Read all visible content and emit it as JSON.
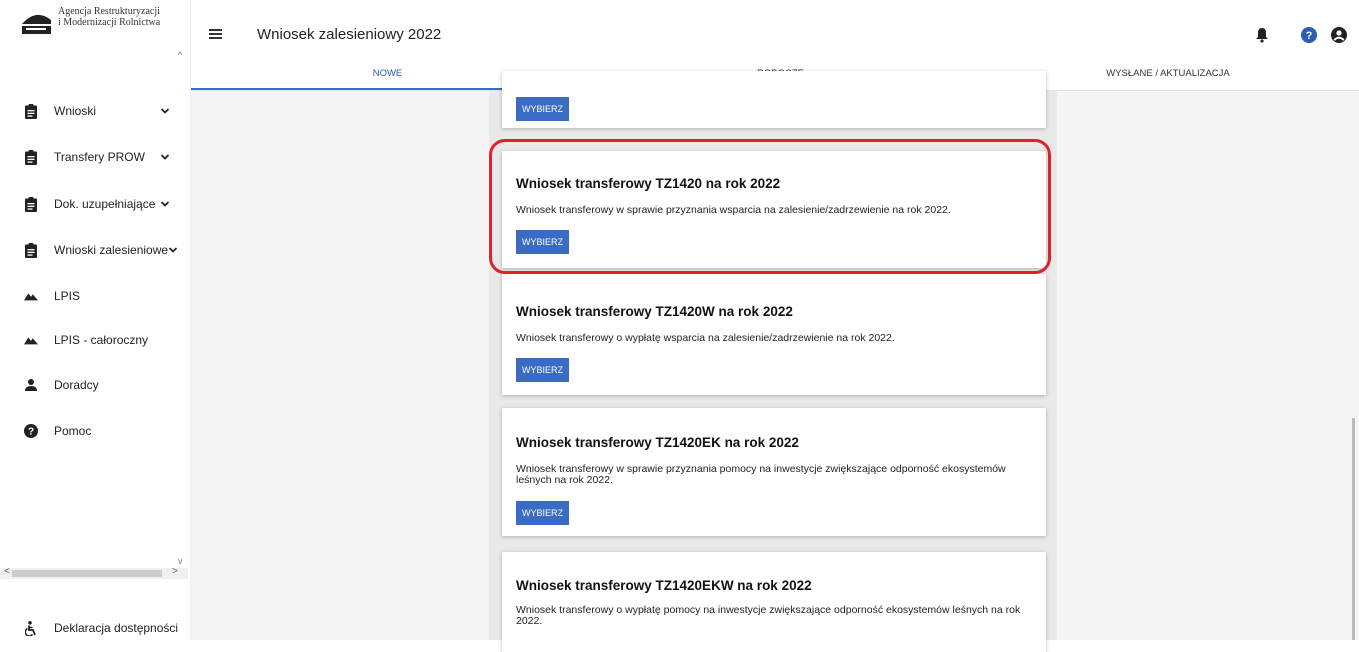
{
  "logo": {
    "line1": "Agencja Restrukturyzacji",
    "line2": "i Modernizacji Rolnictwa"
  },
  "sidebar": {
    "items": [
      {
        "label": "Wnioski",
        "icon": "clipboard-icon",
        "has_chevron": true
      },
      {
        "label": "Transfery PROW",
        "icon": "clipboard-icon",
        "has_chevron": true
      },
      {
        "label": "Dok. uzupełniające",
        "icon": "clipboard-icon",
        "has_chevron": true
      },
      {
        "label": "Wnioski zalesieniowe",
        "icon": "clipboard-icon",
        "has_chevron": true
      },
      {
        "label": "LPIS",
        "icon": "terrain-icon",
        "has_chevron": false
      },
      {
        "label": "LPIS - całoroczny",
        "icon": "terrain-icon",
        "has_chevron": false
      },
      {
        "label": "Doradcy",
        "icon": "person-icon",
        "has_chevron": false
      },
      {
        "label": "Pomoc",
        "icon": "help-circle-icon",
        "has_chevron": false
      }
    ],
    "footer": {
      "label": "Deklaracja dostępności",
      "icon": "accessibility-icon"
    }
  },
  "header": {
    "title": "Wniosek zalesieniowy 2022",
    "icons": [
      "bell-icon",
      "help-icon",
      "account-icon"
    ]
  },
  "tabs": [
    {
      "label": "NOWE",
      "active": true
    },
    {
      "label": "ROBOCZE",
      "active": false
    },
    {
      "label": "WYSŁANE / AKTUALIZACJA",
      "active": false
    }
  ],
  "cards": [
    {
      "title": "",
      "description": "",
      "button": "WYBIERZ"
    },
    {
      "title": "Wniosek transferowy TZ1420 na rok 2022",
      "description": "Wniosek transferowy w sprawie przyznania wsparcia na zalesienie/zadrzewienie na rok 2022.",
      "button": "WYBIERZ",
      "highlighted": true
    },
    {
      "title": "Wniosek transferowy TZ1420W na rok 2022",
      "description": "Wniosek transferowy o wypłatę wsparcia na zalesienie/zadrzewienie na rok 2022.",
      "button": "WYBIERZ"
    },
    {
      "title": "Wniosek transferowy TZ1420EK na rok 2022",
      "description": "Wniosek transferowy w sprawie przyznania pomocy na inwestycje zwiększające odporność ekosystemów leśnych na rok 2022.",
      "button": "WYBIERZ"
    },
    {
      "title": "Wniosek transferowy TZ1420EKW na rok 2022",
      "description": "Wniosek transferowy o wypłatę pomocy na inwestycje zwiększające odporność ekosystemów leśnych na rok 2022.",
      "button": ""
    }
  ],
  "colors": {
    "accent": "#3a6cc4",
    "highlight": "#e0202a"
  }
}
